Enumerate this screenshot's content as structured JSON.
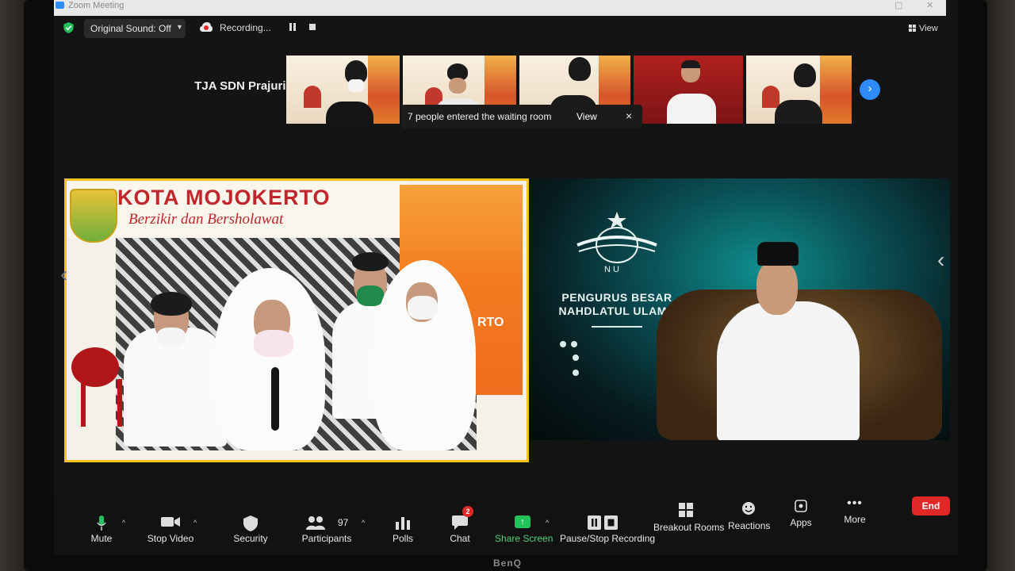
{
  "window": {
    "app_title": "Zoom Meeting"
  },
  "topbar": {
    "original_sound": "Original Sound: Off",
    "recording": "Recording...",
    "view": "View"
  },
  "gallery": {
    "featured_name": "TJA SDN Prajuri..."
  },
  "notification": {
    "message": "7 people entered the waiting room",
    "view": "View",
    "close": "×"
  },
  "left_video": {
    "title": "KOTA MOJOKERTO",
    "subtitle": "Berzikir dan Bersholawat",
    "poster_text": "RTO"
  },
  "right_video": {
    "org_line1": "PENGURUS BESAR",
    "org_line2": "NAHDLATUL ULAMA",
    "logo_letters": "N U"
  },
  "toolbar": {
    "mute": "Mute",
    "stop_video": "Stop Video",
    "security": "Security",
    "participants": "Participants",
    "participants_count": "97",
    "polls": "Polls",
    "chat": "Chat",
    "chat_badge": "2",
    "share_screen": "Share Screen",
    "pause_stop_recording": "Pause/Stop Recording",
    "breakout_rooms": "Breakout Rooms",
    "reactions": "Reactions",
    "apps": "Apps",
    "more": "More",
    "end": "End"
  },
  "monitor": {
    "brand": "BenQ"
  },
  "colors": {
    "accent_blue": "#2d8cff",
    "share_green": "#23c15a",
    "end_red": "#e02828",
    "frame_yellow": "#f0c419"
  }
}
